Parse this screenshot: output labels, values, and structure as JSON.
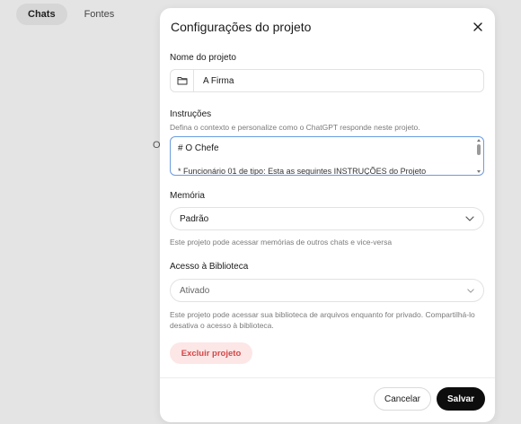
{
  "background": {
    "tabs": [
      {
        "label": "Chats",
        "active": true
      },
      {
        "label": "Fontes",
        "active": false
      }
    ],
    "stray_text": "O"
  },
  "modal": {
    "title": "Configurações do projeto",
    "close_icon": "close-icon",
    "project_name": {
      "label": "Nome do projeto",
      "value": "A Firma",
      "icon": "folder-icon"
    },
    "instructions": {
      "label": "Instruções",
      "hint": "Defina o contexto e personalize como o ChatGPT responde neste projeto.",
      "line1": "# O Chefe",
      "line2": "* Funcionário 01 de tipo: Esta as seguintes INSTRUÇÕES do Projeto"
    },
    "memory": {
      "label": "Memória",
      "selected": "Padrão",
      "hint": "Este projeto pode acessar memórias de outros chats e vice-versa"
    },
    "library": {
      "label": "Acesso à Biblioteca",
      "selected": "Ativado",
      "hint_line1": "Este projeto pode acessar sua biblioteca de arquivos enquanto for privado. Compartilhá-lo",
      "hint_line2": "desativa o acesso à biblioteca."
    },
    "delete_label": "Excluir projeto",
    "cancel_label": "Cancelar",
    "save_label": "Salvar"
  },
  "colors": {
    "focus_border": "#6b9be0",
    "danger_text": "#d44747",
    "danger_bg": "#fde6e6",
    "primary_button": "#0d0d0d"
  }
}
